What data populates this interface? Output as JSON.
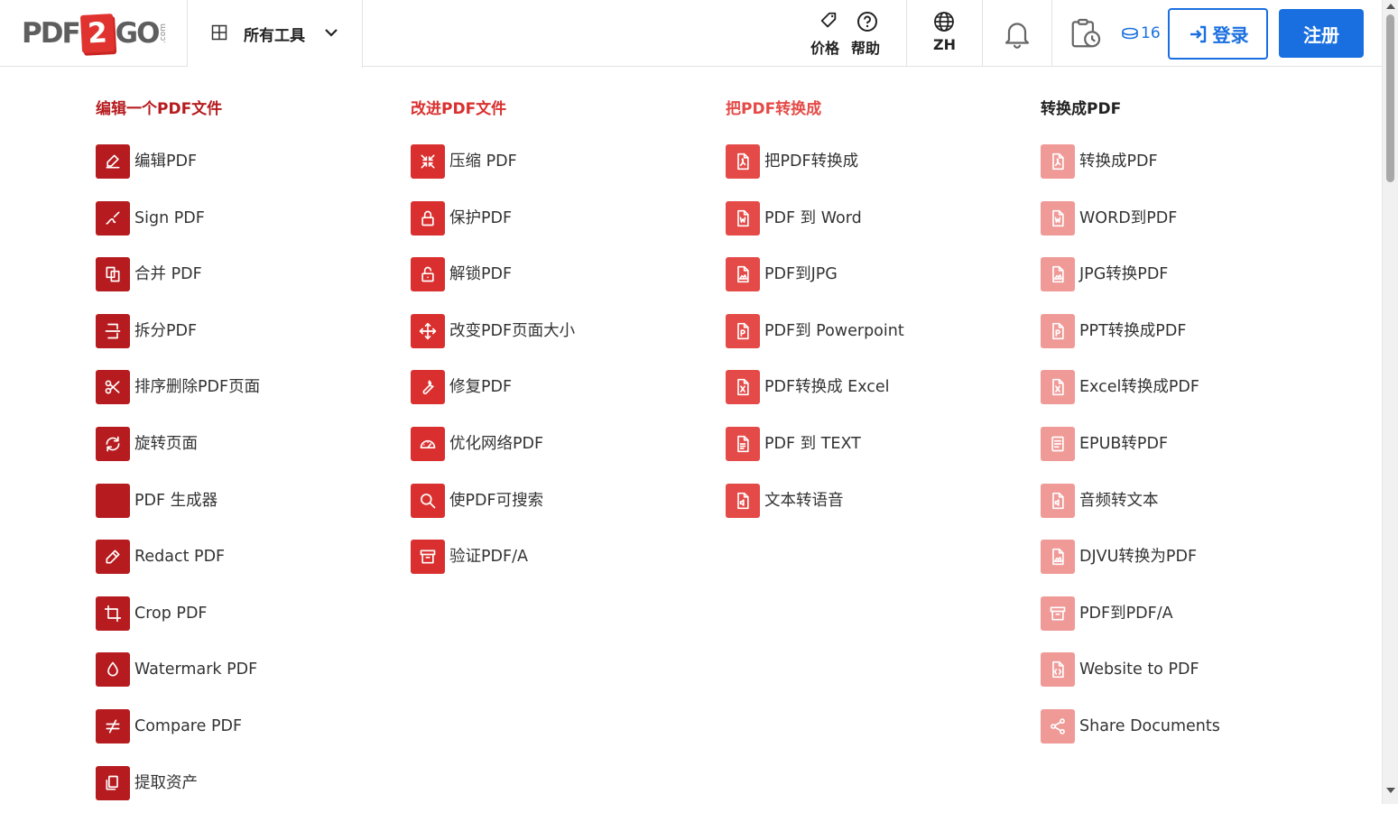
{
  "header": {
    "logo": {
      "part1": "PDF",
      "part2": "2",
      "part3": "GO",
      "suffix": ".com"
    },
    "all_tools_label": "所有工具",
    "price_label": "价格",
    "help_label": "帮助",
    "lang_label": "ZH",
    "credits": "16",
    "login_label": "登录",
    "signup_label": "注册"
  },
  "colors": {
    "col1": "#b61c1f",
    "col2": "#d9302f",
    "col3": "#e44a47",
    "col4": "#ef9a97",
    "accent": "#1a6fe0"
  },
  "columns": [
    {
      "title": "编辑一个PDF文件",
      "items": [
        {
          "label": "编辑PDF",
          "icon": "edit-icon"
        },
        {
          "label": "Sign PDF",
          "icon": "sign-icon"
        },
        {
          "label": "合并 PDF",
          "icon": "merge-icon"
        },
        {
          "label": "拆分PDF",
          "icon": "split-icon"
        },
        {
          "label": "排序删除PDF页面",
          "icon": "scissors-icon"
        },
        {
          "label": "旋转页面",
          "icon": "rotate-icon"
        },
        {
          "label": "PDF 生成器",
          "icon": "blank-icon"
        },
        {
          "label": "Redact PDF",
          "icon": "pencil-icon"
        },
        {
          "label": "Crop PDF",
          "icon": "crop-icon"
        },
        {
          "label": "Watermark PDF",
          "icon": "droplet-icon"
        },
        {
          "label": "Compare PDF",
          "icon": "not-equal-icon"
        },
        {
          "label": "提取资产",
          "icon": "extract-icon"
        }
      ]
    },
    {
      "title": "改进PDF文件",
      "items": [
        {
          "label": "压缩 PDF",
          "icon": "compress-icon"
        },
        {
          "label": "保护PDF",
          "icon": "lock-icon"
        },
        {
          "label": "解锁PDF",
          "icon": "unlock-icon"
        },
        {
          "label": "改变PDF页面大小",
          "icon": "move-icon"
        },
        {
          "label": "修复PDF",
          "icon": "wrench-icon"
        },
        {
          "label": "优化网络PDF",
          "icon": "gauge-icon"
        },
        {
          "label": "使PDF可搜索",
          "icon": "search-icon"
        },
        {
          "label": "验证PDF/A",
          "icon": "archive-icon"
        }
      ]
    },
    {
      "title": "把PDF转换成",
      "items": [
        {
          "label": "把PDF转换成",
          "icon": "file-pdf-icon"
        },
        {
          "label": "PDF 到 Word",
          "icon": "file-word-icon"
        },
        {
          "label": "PDF到JPG",
          "icon": "file-image-icon"
        },
        {
          "label": "PDF到 Powerpoint",
          "icon": "file-powerpoint-icon"
        },
        {
          "label": "PDF转换成 Excel",
          "icon": "file-excel-icon"
        },
        {
          "label": "PDF 到 TEXT",
          "icon": "file-text-icon"
        },
        {
          "label": "文本转语音",
          "icon": "file-audio-icon"
        }
      ]
    },
    {
      "title": "转换成PDF",
      "items": [
        {
          "label": "转换成PDF",
          "icon": "file-pdf-icon"
        },
        {
          "label": "WORD到PDF",
          "icon": "file-word-icon"
        },
        {
          "label": "JPG转换PDF",
          "icon": "file-image-icon"
        },
        {
          "label": "PPT转换成PDF",
          "icon": "file-powerpoint-icon"
        },
        {
          "label": "Excel转换成PDF",
          "icon": "file-excel-icon"
        },
        {
          "label": "EPUB转PDF",
          "icon": "book-icon"
        },
        {
          "label": "音频转文本",
          "icon": "file-audio-icon"
        },
        {
          "label": "DJVU转换为PDF",
          "icon": "file-image-icon"
        },
        {
          "label": "PDF到PDF/A",
          "icon": "archive-icon"
        },
        {
          "label": "Website to PDF",
          "icon": "file-code-icon"
        },
        {
          "label": "Share Documents",
          "icon": "share-icon"
        }
      ]
    }
  ]
}
